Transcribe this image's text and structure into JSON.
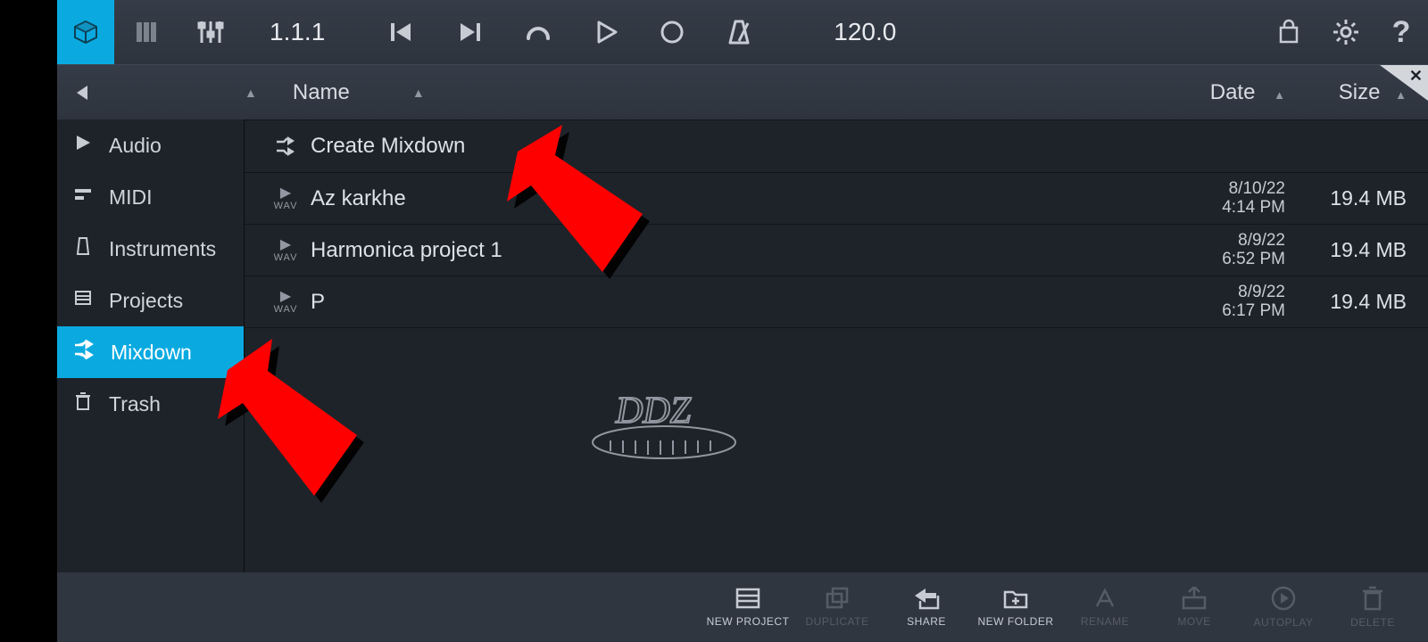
{
  "topbar": {
    "position": "1.1.1",
    "tempo": "120.0"
  },
  "columns": {
    "name": "Name",
    "date": "Date",
    "size": "Size"
  },
  "sidebar": [
    {
      "icon": "play",
      "label": "Audio",
      "active": false
    },
    {
      "icon": "midi",
      "label": "MIDI",
      "active": false
    },
    {
      "icon": "instr",
      "label": "Instruments",
      "active": false
    },
    {
      "icon": "proj",
      "label": "Projects",
      "active": false
    },
    {
      "icon": "mix",
      "label": "Mixdown",
      "active": true
    },
    {
      "icon": "trash",
      "label": "Trash",
      "active": false
    }
  ],
  "create_label": "Create Mixdown",
  "files": [
    {
      "name": "Az karkhe",
      "date": "8/10/22",
      "time": "4:14 PM",
      "size": "19.4 MB"
    },
    {
      "name": "Harmonica project 1",
      "date": "8/9/22",
      "time": "6:52 PM",
      "size": "19.4 MB"
    },
    {
      "name": "P",
      "date": "8/9/22",
      "time": "6:17 PM",
      "size": "19.4 MB"
    }
  ],
  "bottom": [
    {
      "label": "NEW PROJECT",
      "disabled": false,
      "icon": "newproj"
    },
    {
      "label": "DUPLICATE",
      "disabled": true,
      "icon": "dup"
    },
    {
      "label": "SHARE",
      "disabled": false,
      "icon": "share"
    },
    {
      "label": "NEW FOLDER",
      "disabled": false,
      "icon": "newfolder"
    },
    {
      "label": "RENAME",
      "disabled": true,
      "icon": "rename"
    },
    {
      "label": "MOVE",
      "disabled": true,
      "icon": "move"
    },
    {
      "label": "AUTOPLAY",
      "disabled": true,
      "icon": "autoplay"
    },
    {
      "label": "DELETE",
      "disabled": true,
      "icon": "delete"
    }
  ],
  "watermark": "DDZ"
}
